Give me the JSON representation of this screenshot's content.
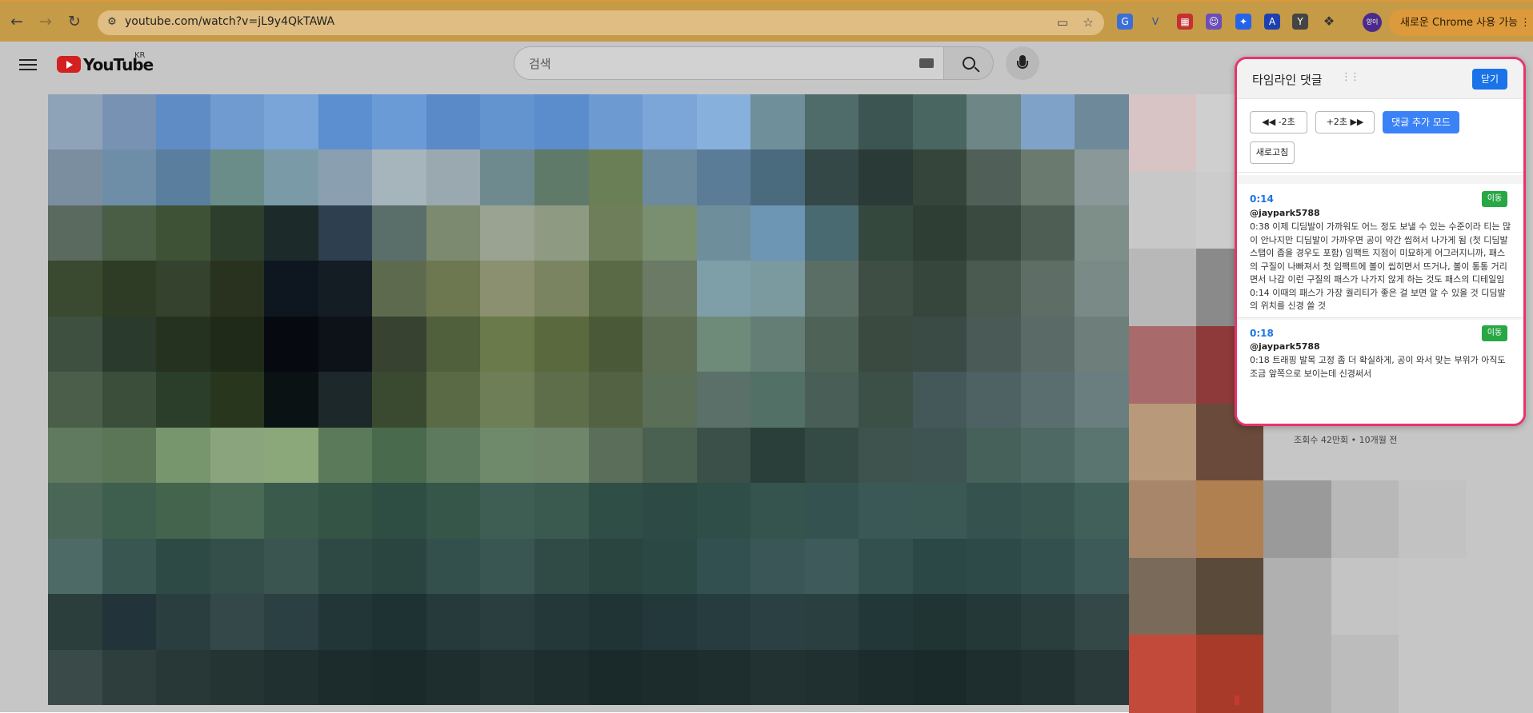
{
  "browser": {
    "url": "youtube.com/watch?v=jL9y4QkTAWA",
    "update_button": "새로운 Chrome 사용 가능",
    "profile_label": "양이"
  },
  "youtube": {
    "logo_text": "YouTube",
    "region": "KR",
    "search_placeholder": "검색",
    "side_video_meta": "조회수 42만회 • 10개월 전"
  },
  "panel": {
    "title": "타임라인 댓글",
    "drag_handle": "⋮⋮",
    "close_label": "닫기",
    "back_label": "◀◀ -2초",
    "forward_label": "+2초 ▶▶",
    "add_mode_label": "댓글 추가 모드",
    "refresh_label": "새로고침",
    "comments": [
      {
        "time": "0:14",
        "go_label": "이동",
        "user": "@jaypark5788",
        "text": "0:38 이제 디딤발이 가까워도 어느 정도 보낼 수 있는 수준이라 티는 많이 안나지만 디딤발이 가까우면 공이 약간 씹혀서 나가게 됨 (첫 디딤발 스탭이 좁을 경우도 포함) 임팩트 지점이 미묘하게 어그러지니까, 패스의 구질이 나빠져서 첫 임팩트에 볼이 씹히면서 뜨거나, 볼이 통통 거리면서 나감 이런 구질의 패스가 나가지 않게 하는 것도 패스의 디테일임 0:14 이때의 패스가 가장 퀄리티가 좋은 걸 보면 알 수 있을 것 디딤발의 위치를 신경 쓸 것"
      },
      {
        "time": "0:18",
        "go_label": "이동",
        "user": "@jaypark5788",
        "text": "0:18 트래핑 발목 고정 좀 더 확실하게, 공이 와서 맞는 부위가 아직도 조금 앞쪽으로 보이는데 신경써서"
      }
    ]
  },
  "colors": {
    "accent": "#1a73e8",
    "primary_button": "#3b82f6",
    "go_button": "#28a745",
    "panel_border": "#e8336b",
    "chrome_bar": "#c69b47"
  }
}
